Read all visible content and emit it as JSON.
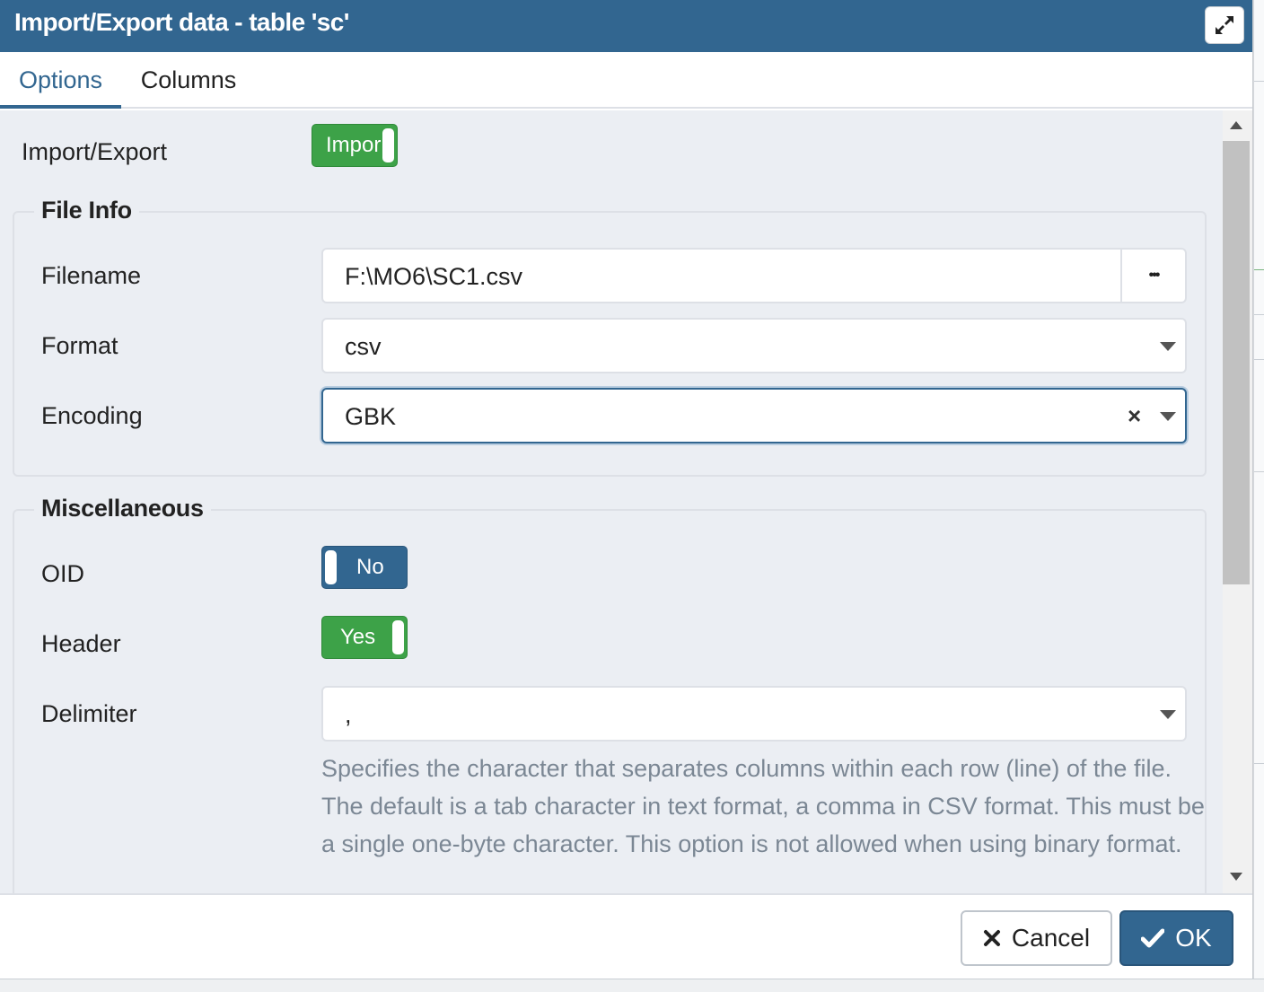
{
  "dialog": {
    "title": "Import/Export data - table 'sc'",
    "maximize_icon": "expand-arrows-icon"
  },
  "tabs": [
    {
      "label": "Options",
      "active": true
    },
    {
      "label": "Columns",
      "active": false
    }
  ],
  "options": {
    "import_export": {
      "label": "Import/Export",
      "toggle_text": "Impor",
      "state": "Import"
    },
    "file_info": {
      "legend": "File Info",
      "filename": {
        "label": "Filename",
        "value": "F:\\MO6\\SC1.csv",
        "browse_label": "•••"
      },
      "format": {
        "label": "Format",
        "value": "csv"
      },
      "encoding": {
        "label": "Encoding",
        "value": "GBK",
        "clear": "×"
      }
    },
    "misc": {
      "legend": "Miscellaneous",
      "oid": {
        "label": "OID",
        "toggle_text": "No"
      },
      "header": {
        "label": "Header",
        "toggle_text": "Yes"
      },
      "delimiter": {
        "label": "Delimiter",
        "value": ",",
        "help": "Specifies the character that separates columns within each row (line) of the file. The default is a tab character in text format, a comma in CSV format. This must be a single one-byte character. This option is not allowed when using binary format."
      }
    }
  },
  "footer": {
    "cancel_label": "Cancel",
    "ok_label": "OK"
  },
  "colors": {
    "primary": "#326690",
    "toggle_on": "#3da248",
    "help_text": "#7b8794"
  }
}
